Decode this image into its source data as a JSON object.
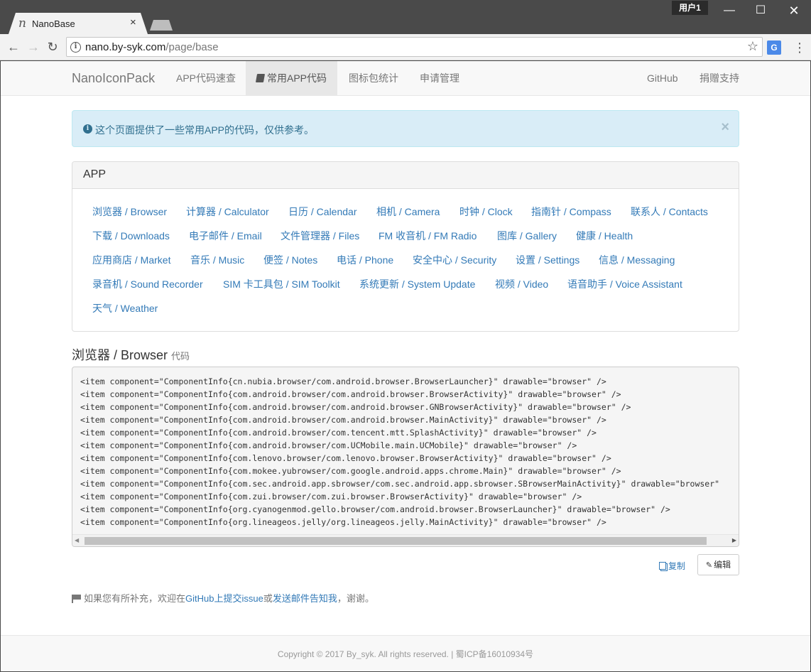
{
  "browser": {
    "tab_title": "NanoBase",
    "tab_favicon": "n",
    "tab_close": "×",
    "user_label": "用户1",
    "window_min": "—",
    "window_max": "☐",
    "window_close": "✕",
    "url_host": "nano.by-syk.com",
    "url_path": "/page/base",
    "icons": [
      "back-icon",
      "forward-icon",
      "reload-icon",
      "info-icon",
      "star-icon",
      "translate-icon",
      "menu-icon"
    ]
  },
  "navbar": {
    "brand": "NanoIconPack",
    "links": [
      {
        "label": "APP代码速查"
      },
      {
        "label": "常用APP代码",
        "active": true
      },
      {
        "label": "图标包统计"
      },
      {
        "label": "申请管理"
      }
    ],
    "right_links": [
      {
        "label": "GitHub"
      },
      {
        "label": "捐赠支持"
      }
    ]
  },
  "alert": {
    "text": "这个页面提供了一些常用APP的代码，仅供参考。",
    "close": "×"
  },
  "app_panel": {
    "heading": "APP",
    "rows": [
      [
        "浏览器 / Browser",
        "计算器 / Calculator",
        "日历 / Calendar",
        "相机 / Camera",
        "时钟 / Clock",
        "指南针 / Compass",
        "联系人 / Contacts"
      ],
      [
        "下载 / Downloads",
        "电子邮件 / Email",
        "文件管理器 / Files",
        "FM 收音机 / FM Radio",
        "图库 / Gallery",
        "健康 / Health"
      ],
      [
        "应用商店 / Market",
        "音乐 / Music",
        "便签 / Notes",
        "电话 / Phone",
        "安全中心 / Security",
        "设置 / Settings",
        "信息 / Messaging"
      ],
      [
        "录音机 / Sound Recorder",
        "SIM 卡工具包 / SIM Toolkit",
        "系统更新 / System Update",
        "视频 / Video",
        "语音助手 / Voice Assistant"
      ],
      [
        "天气 / Weather"
      ]
    ]
  },
  "code_section": {
    "title": "浏览器 / Browser",
    "subtitle": "代码",
    "lines": [
      "<item component=\"ComponentInfo{cn.nubia.browser/com.android.browser.BrowserLauncher}\" drawable=\"browser\" />",
      "<item component=\"ComponentInfo{com.android.browser/com.android.browser.BrowserActivity}\" drawable=\"browser\" />",
      "<item component=\"ComponentInfo{com.android.browser/com.android.browser.GNBrowserActivity}\" drawable=\"browser\" />",
      "<item component=\"ComponentInfo{com.android.browser/com.android.browser.MainActivity}\" drawable=\"browser\" />",
      "<item component=\"ComponentInfo{com.android.browser/com.tencent.mtt.SplashActivity}\" drawable=\"browser\" />",
      "<item component=\"ComponentInfo{com.android.browser/com.UCMobile.main.UCMobile}\" drawable=\"browser\" />",
      "<item component=\"ComponentInfo{com.lenovo.browser/com.lenovo.browser.BrowserActivity}\" drawable=\"browser\" />",
      "<item component=\"ComponentInfo{com.mokee.yubrowser/com.google.android.apps.chrome.Main}\" drawable=\"browser\" />",
      "<item component=\"ComponentInfo{com.sec.android.app.sbrowser/com.sec.android.app.sbrowser.SBrowserMainActivity}\" drawable=\"browser\"",
      "<item component=\"ComponentInfo{com.zui.browser/com.zui.browser.BrowserActivity}\" drawable=\"browser\" />",
      "<item component=\"ComponentInfo{org.cyanogenmod.gello.browser/com.android.browser.BrowserLauncher}\" drawable=\"browser\" />",
      "<item component=\"ComponentInfo{org.lineageos.jelly/org.lineageos.jelly.MainActivity}\" drawable=\"browser\" />"
    ],
    "copy_label": "复制",
    "edit_label": "编辑"
  },
  "note": {
    "prefix": "如果您有所补充，欢迎在",
    "link1": "GitHub上提交issue",
    "middle": "或",
    "link2": "发送邮件告知我",
    "suffix": "，谢谢。"
  },
  "footer": {
    "text": "Copyright © 2017 By_syk. All rights reserved. | 蜀ICP备16010934号"
  },
  "colors": {
    "link": "#337ab7",
    "alert_bg": "#d9edf7",
    "alert_text": "#31708f",
    "chrome": "#4a4a4a"
  }
}
